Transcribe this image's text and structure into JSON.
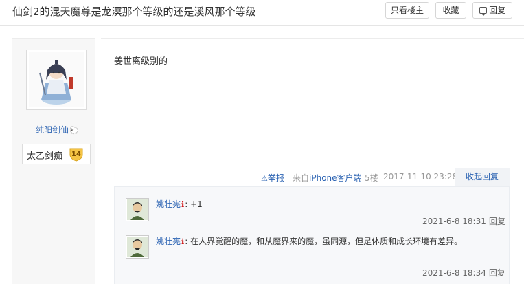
{
  "header": {
    "title": "仙剑2的混天魔尊是龙溟那个等级的还是溪风那个等级",
    "btn_louzhu": "只看楼主",
    "btn_collect": "收藏",
    "btn_reply": "回复"
  },
  "author": {
    "username": "纯阳剑仙",
    "level_name": "太乙剑痴",
    "level": "14"
  },
  "post": {
    "content": "姜世离级别的",
    "report": "举报",
    "from_prefix": "来自",
    "from_device": "iPhone客户端",
    "floor": "5楼",
    "time": "2017-11-10 23:28",
    "fold": "收起回复"
  },
  "replies": [
    {
      "user": "姚壮宪",
      "text": "+1",
      "time": "2021-6-8 18:31",
      "reply_label": "回复"
    },
    {
      "user": "姚壮宪",
      "text": "在人界觉醒的魔，和从魔界来的魔，虽同源，但是体质和成长环境有差异。",
      "time": "2021-6-8 18:34",
      "reply_label": "回复"
    }
  ],
  "colors": {
    "link": "#2d64b3",
    "badge": "#f5c445"
  }
}
